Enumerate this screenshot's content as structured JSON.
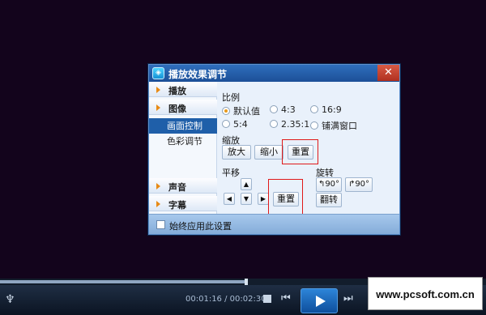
{
  "dialog": {
    "title": "播放效果调节",
    "icon": "player-settings-icon",
    "close_glyph": "✕"
  },
  "sidebar": {
    "categories": [
      {
        "label": "播放"
      },
      {
        "label": "图像"
      },
      {
        "label": "声音"
      },
      {
        "label": "字幕"
      }
    ],
    "subitems": [
      {
        "label": "画面控制",
        "active": true
      },
      {
        "label": "色彩调节",
        "active": false
      }
    ]
  },
  "ratio": {
    "label": "比例",
    "options": [
      {
        "label": "默认值",
        "checked": true
      },
      {
        "label": "4:3",
        "checked": false
      },
      {
        "label": "16:9",
        "checked": false
      },
      {
        "label": "5:4",
        "checked": false
      },
      {
        "label": "2.35:1",
        "checked": false
      },
      {
        "label": "铺满窗口",
        "checked": false
      }
    ]
  },
  "zoom": {
    "label": "缩放",
    "zoom_in": "放大",
    "zoom_out": "缩小",
    "reset": "重置"
  },
  "pan": {
    "label": "平移",
    "reset": "重置",
    "up": "▲",
    "down": "▼",
    "left": "◀",
    "right": "▶"
  },
  "rotate": {
    "label": "旋转",
    "rotate_left": "↰90°",
    "rotate_right": "↱90°",
    "flip": "翻转"
  },
  "footer": {
    "always_apply": "始终应用此设置",
    "checked": false
  },
  "player": {
    "time": "00:01:16 / 00:02:30",
    "progress": 0.507
  },
  "watermark": "www.pcsoft.com.cn",
  "colors": {
    "title_bar": "#1c4f97",
    "active_item": "#1f5fa9",
    "highlight": "#e01919",
    "play_button": "#2d84d8"
  }
}
